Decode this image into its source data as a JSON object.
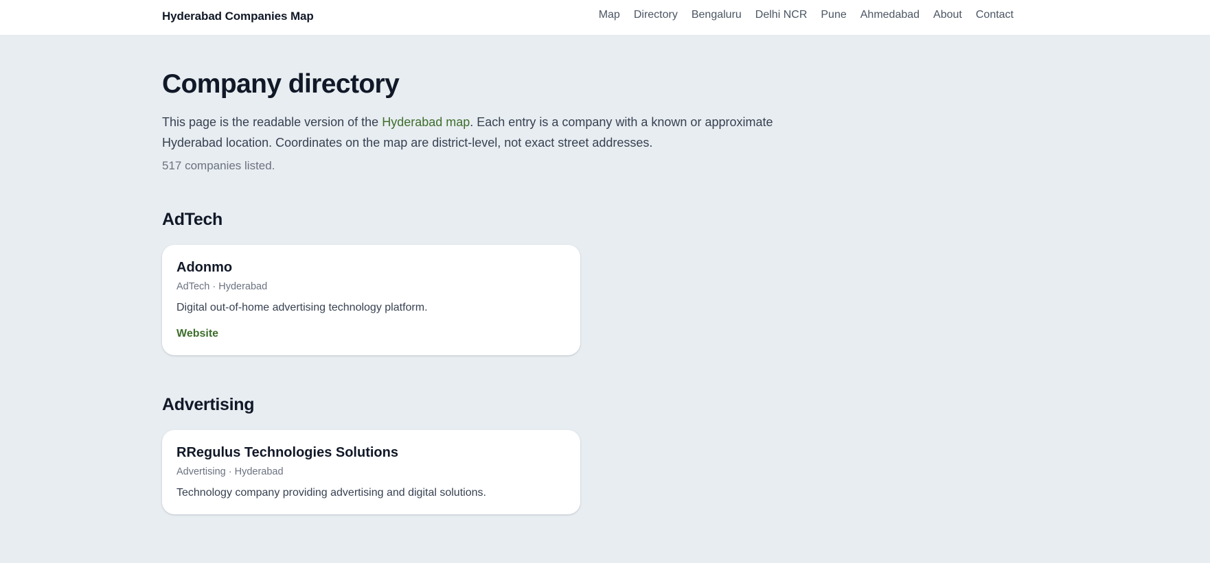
{
  "header": {
    "brand": "Hyderabad Companies Map",
    "nav": [
      "Map",
      "Directory",
      "Bengaluru",
      "Delhi NCR",
      "Pune",
      "Ahmedabad",
      "About",
      "Contact"
    ]
  },
  "main": {
    "title": "Company directory",
    "intro_before": "This page is the readable version of the ",
    "intro_link": "Hyderabad map",
    "intro_after": ". Each entry is a company with a known or approximate Hyderabad location. Coordinates on the map are district-level, not exact street addresses.",
    "count": "517 companies listed."
  },
  "categories": [
    {
      "title": "AdTech",
      "companies": [
        {
          "name": "Adonmo",
          "meta": "AdTech · Hyderabad",
          "description": "Digital out-of-home advertising technology platform.",
          "link": "Website"
        }
      ]
    },
    {
      "title": "Advertising",
      "companies": [
        {
          "name": "RRegulus Technologies Solutions",
          "meta": "Advertising · Hyderabad",
          "description": "Technology company providing advertising and digital solutions."
        }
      ]
    }
  ],
  "colors": {
    "background": "#e8edf1",
    "accent": "#3d6e2c",
    "header_bg": "#ffffff"
  }
}
